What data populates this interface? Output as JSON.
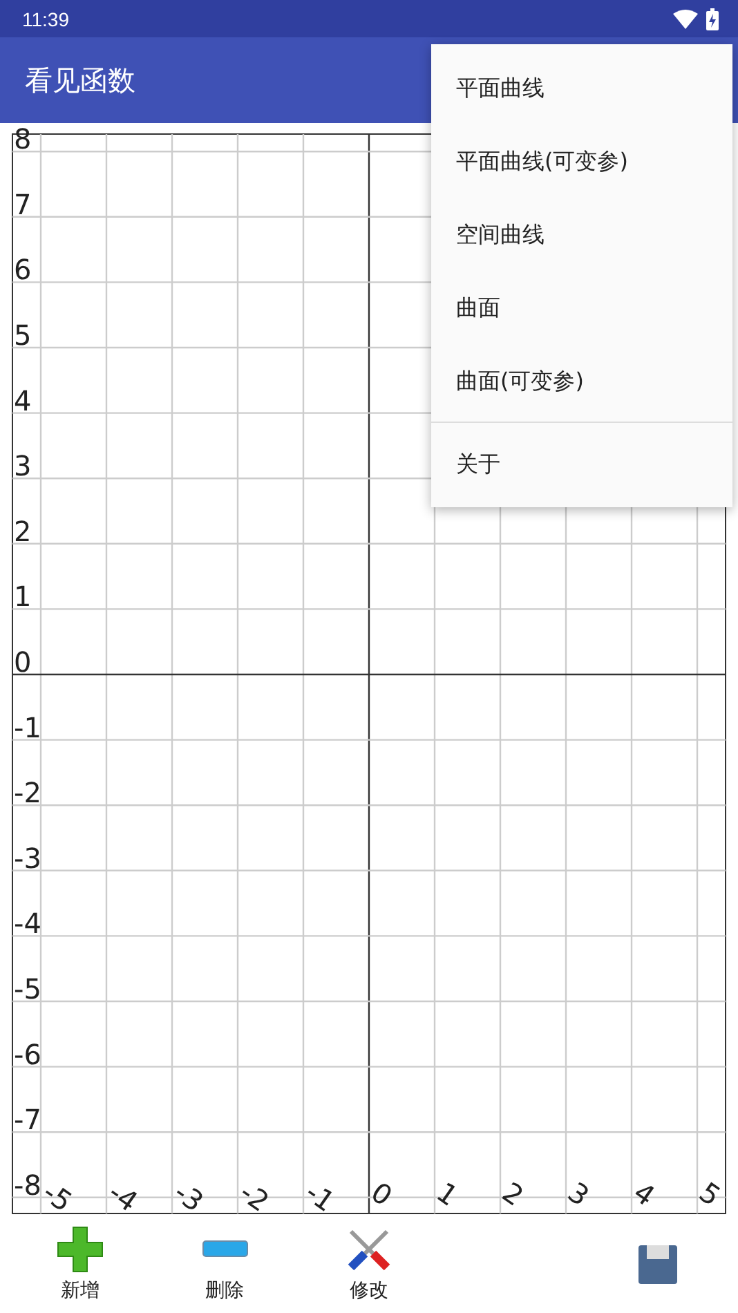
{
  "status_bar": {
    "time": "11:39"
  },
  "app_bar": {
    "title": "看见函数"
  },
  "graph": {
    "x_labels": [
      "-5",
      "-4",
      "-3",
      "-2",
      "-1",
      "0",
      "1",
      "2",
      "3",
      "4",
      "5"
    ],
    "y_labels": [
      "8",
      "7",
      "6",
      "5",
      "4",
      "3",
      "2",
      "1",
      "0",
      "-1",
      "-2",
      "-3",
      "-4",
      "-5",
      "-6",
      "-7",
      "-8"
    ]
  },
  "menu": {
    "items": [
      {
        "label": "平面曲线",
        "kind": "item"
      },
      {
        "label": "平面曲线(可变参)",
        "kind": "item"
      },
      {
        "label": "空间曲线",
        "kind": "item"
      },
      {
        "label": "曲面",
        "kind": "item"
      },
      {
        "label": "曲面(可变参)",
        "kind": "item"
      },
      {
        "label": "关于",
        "kind": "separated"
      }
    ]
  },
  "toolbar": [
    {
      "kind": "add",
      "label": "新增"
    },
    {
      "kind": "remove",
      "label": "删除"
    },
    {
      "kind": "edit",
      "label": "修改"
    },
    {
      "kind": "blank"
    },
    {
      "kind": "save"
    }
  ]
}
